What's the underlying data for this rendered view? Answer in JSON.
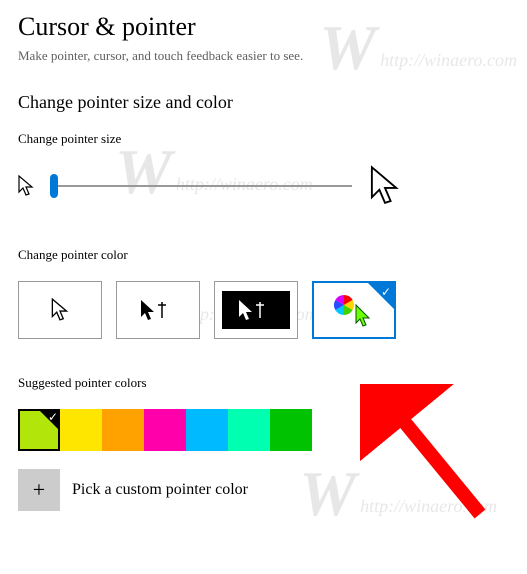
{
  "header": {
    "title": "Cursor & pointer",
    "description": "Make pointer, cursor, and touch feedback easier to see."
  },
  "sizeSection": {
    "heading": "Change pointer size and color",
    "sliderLabel": "Change pointer size",
    "sliderValue": 0
  },
  "colorSection": {
    "label": "Change pointer color",
    "options": [
      {
        "name": "white-pointer"
      },
      {
        "name": "black-pointer"
      },
      {
        "name": "inverted-pointer"
      },
      {
        "name": "custom-color-pointer",
        "selected": true
      }
    ]
  },
  "suggested": {
    "label": "Suggested pointer colors",
    "swatches": [
      {
        "color": "#b2e60b",
        "selected": true
      },
      {
        "color": "#ffe600"
      },
      {
        "color": "#ffa200"
      },
      {
        "color": "#ff00aa"
      },
      {
        "color": "#00baff"
      },
      {
        "color": "#00ffb0"
      },
      {
        "color": "#00c200"
      }
    ]
  },
  "custom": {
    "label": "Pick a custom pointer color"
  },
  "watermark": "http://winaero.com"
}
